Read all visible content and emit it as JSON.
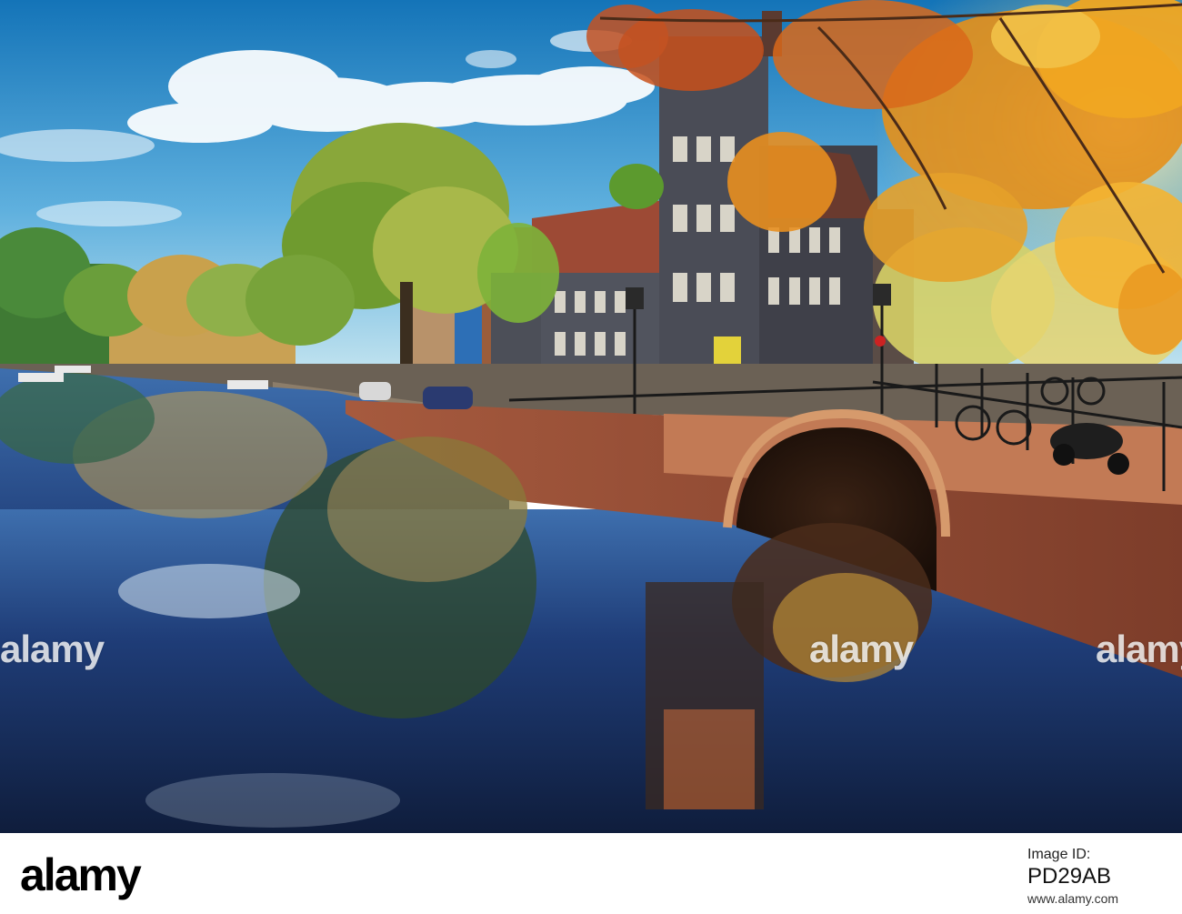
{
  "watermark": {
    "text": "alamy"
  },
  "footer": {
    "brand": "alamy",
    "image_id_label": "Image ID:",
    "image_id": "PD29AB",
    "site": "www.alamy.com"
  },
  "colors": {
    "sky_top": "#1a7cc1",
    "sky_bottom": "#9fd3ee",
    "water_dark": "#1d2f58",
    "brick": "#a8583e",
    "autumn_leaf": "#e8901c"
  }
}
